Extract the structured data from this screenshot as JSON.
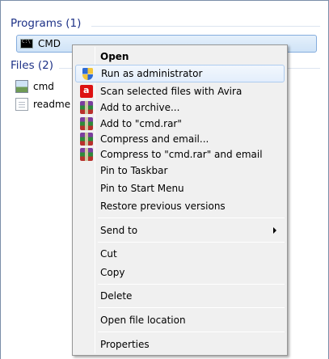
{
  "sections": {
    "programs_header": "Programs (1)",
    "files_header": "Files (2)"
  },
  "programs": [
    {
      "label": "CMD",
      "icon": "cmd-icon"
    }
  ],
  "files": [
    {
      "label": "cmd",
      "icon": "image-file-icon"
    },
    {
      "label": "readme",
      "icon": "text-file-icon"
    }
  ],
  "menu": {
    "open": "Open",
    "run_as_admin": "Run as administrator",
    "scan_avira": "Scan selected files with Avira",
    "add_archive": "Add to archive...",
    "add_cmd_rar": "Add to \"cmd.rar\"",
    "compress_email": "Compress and email...",
    "compress_cmd_rar_email": "Compress to \"cmd.rar\" and email",
    "pin_taskbar": "Pin to Taskbar",
    "pin_start": "Pin to Start Menu",
    "restore_versions": "Restore previous versions",
    "send_to": "Send to",
    "cut": "Cut",
    "copy": "Copy",
    "delete": "Delete",
    "open_location": "Open file location",
    "properties": "Properties"
  },
  "colors": {
    "header_text": "#1e3287",
    "selection_border": "#84acdd",
    "menu_bg": "#f0f0f0"
  }
}
